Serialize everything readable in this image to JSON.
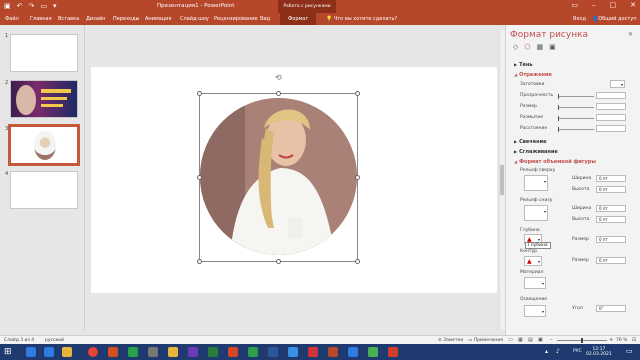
{
  "titlebar": {
    "doc_title": "Презентация1 - PowerPoint",
    "tools_context": "Работа с рисунками",
    "login": "Вход",
    "share": "Общий доступ"
  },
  "ribbon": {
    "tabs": [
      "Файл",
      "Главная",
      "Вставка",
      "Дизайн",
      "Переходы",
      "Анимация",
      "Слайд-шоу",
      "Рецензирование",
      "Вид",
      "Формат"
    ],
    "active_tab": "Формат",
    "tellme_placeholder": "Что вы хотите сделать?"
  },
  "thumbnails": [
    {
      "num": "1"
    },
    {
      "num": "2"
    },
    {
      "num": "3"
    },
    {
      "num": "4"
    }
  ],
  "pane": {
    "title": "Формат рисунка",
    "sections": {
      "shadow": "Тень",
      "reflection": "Отражение",
      "glow": "Свечение",
      "smoothing": "Сглаживание",
      "bevel3d": "Формат объемной фигуры"
    },
    "reflection": {
      "presets": "Заготовки",
      "transparency": "Прозрачность",
      "size": "Размер",
      "blur": "Размытие",
      "distance": "Расстояние"
    },
    "bevel": {
      "top_bevel": "Рельеф сверху",
      "bottom_bevel": "Рельеф снизу",
      "width": "Ширина",
      "height": "Высота",
      "top_width_value": "0 пт",
      "top_height_value": "0 пт",
      "bottom_width_value": "0 пт",
      "bottom_height_value": "0 пт",
      "depth": "Глубина",
      "depth_size_label": "Размер",
      "depth_size_value": "0 пт",
      "contour": "Контур",
      "contour_size_label": "Размер",
      "contour_size_value": "0 пт",
      "material": "Материал",
      "lighting": "Освещение",
      "angle_label": "Угол",
      "angle_value": "0°"
    },
    "tooltip": "Глубина"
  },
  "statusbar": {
    "slide_info": "Слайд 3 из 4",
    "language": "русский",
    "notes": "Заметки",
    "comments": "Примечания",
    "zoom": "76 %"
  },
  "taskbar": {
    "lang": "РУС",
    "time": "12:17",
    "date": "02.03.2021"
  },
  "colors": {
    "accent": "#b7472a",
    "accent_dark": "#8e2f1a",
    "pane_heading": "#c0504d",
    "taskbar": "#1e3a6e"
  }
}
